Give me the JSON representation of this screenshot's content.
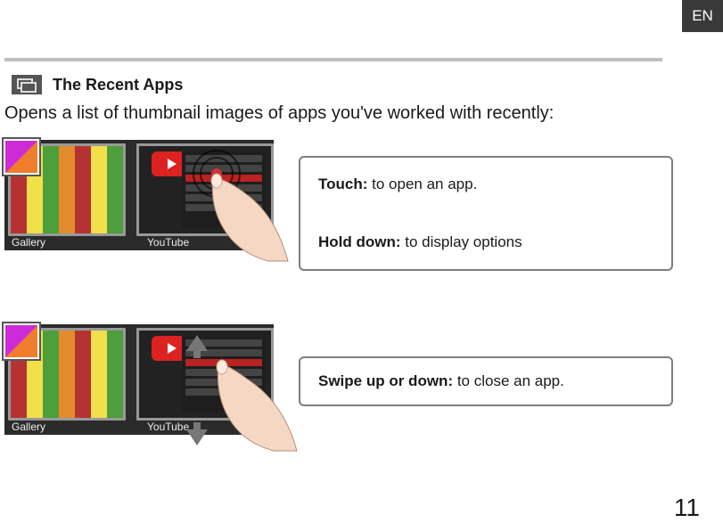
{
  "lang_tab": "EN",
  "section": {
    "title": "The Recent Apps",
    "description": "Opens a list of thumbnail images of apps you've worked with recently:"
  },
  "thumbnails": {
    "gallery_label": "Gallery",
    "youtube_label": "YouTube"
  },
  "callouts": {
    "touch_label": "Touch:",
    "touch_text": " to open an app.",
    "hold_label": "Hold down:",
    "hold_text": " to display options",
    "swipe_label": "Swipe up or down:",
    "swipe_text": " to close an app."
  },
  "page_number": "11"
}
